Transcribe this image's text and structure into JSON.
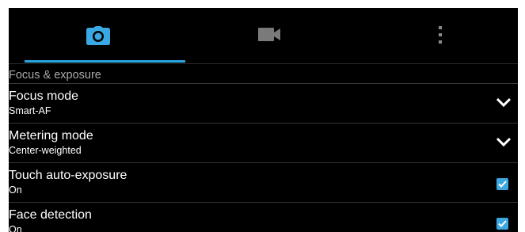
{
  "tabs": [
    {
      "icon": "camera-icon",
      "selected": true
    },
    {
      "icon": "video-camera-icon",
      "selected": false
    },
    {
      "icon": "more-vert-icon",
      "selected": false
    }
  ],
  "section": {
    "title": "Focus & exposure"
  },
  "settings": [
    {
      "title": "Focus mode",
      "value": "Smart-AF",
      "control": "dropdown"
    },
    {
      "title": "Metering mode",
      "value": "Center-weighted",
      "control": "dropdown"
    },
    {
      "title": "Touch auto-exposure",
      "value": "On",
      "control": "checkbox",
      "checked": true
    },
    {
      "title": "Face detection",
      "value": "On",
      "control": "checkbox",
      "checked": true
    }
  ],
  "colors": {
    "accent": "#29a8e0",
    "background": "#000000",
    "text": "#ffffff",
    "muted": "#a9a9a9"
  }
}
